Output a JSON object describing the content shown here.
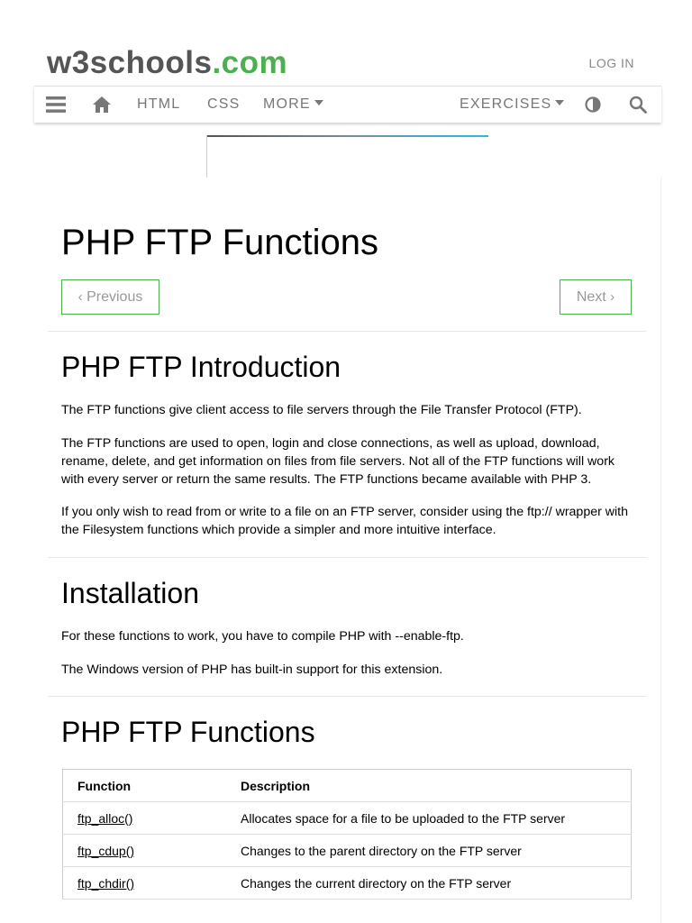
{
  "brand": {
    "name": "w3schools",
    "tld": ".com"
  },
  "header": {
    "login": "LOG IN"
  },
  "nav": {
    "html": "HTML",
    "css": "CSS",
    "more": "MORE",
    "exercises": "EXERCISES"
  },
  "page": {
    "title": "PHP FTP Functions",
    "prev": "Previous",
    "next": "Next"
  },
  "intro": {
    "heading": "PHP FTP Introduction",
    "p1": "The FTP functions give client access to file servers through the File Transfer Protocol (FTP).",
    "p2": "The FTP functions are used to open, login and close connections, as well as upload, download, rename, delete, and get information on files from file servers. Not all of the FTP functions will work with every server or return the same results. The FTP functions became available with PHP 3.",
    "p3": "If you only wish to read from or write to a file on an FTP server, consider using the ftp:// wrapper with the Filesystem functions which provide a simpler and more intuitive interface."
  },
  "install": {
    "heading": "Installation",
    "p1": "For these functions to work, you have to compile PHP with --enable-ftp.",
    "p2": "The Windows version of PHP has built-in support for this extension."
  },
  "functions": {
    "heading": "PHP FTP Functions",
    "col_function": "Function",
    "col_description": "Description",
    "rows": [
      {
        "name": "ftp_alloc()",
        "desc": "Allocates space for a file to be uploaded to the FTP server"
      },
      {
        "name": "ftp_cdup()",
        "desc": "Changes to the parent directory on the FTP server"
      },
      {
        "name": "ftp_chdir()",
        "desc": "Changes the current directory on the FTP server"
      }
    ]
  },
  "icons": [
    "menu-icon",
    "home-icon",
    "contrast-icon",
    "search-icon"
  ],
  "colors": {
    "accent": "#4CAF50",
    "nav_text": "#777777"
  }
}
